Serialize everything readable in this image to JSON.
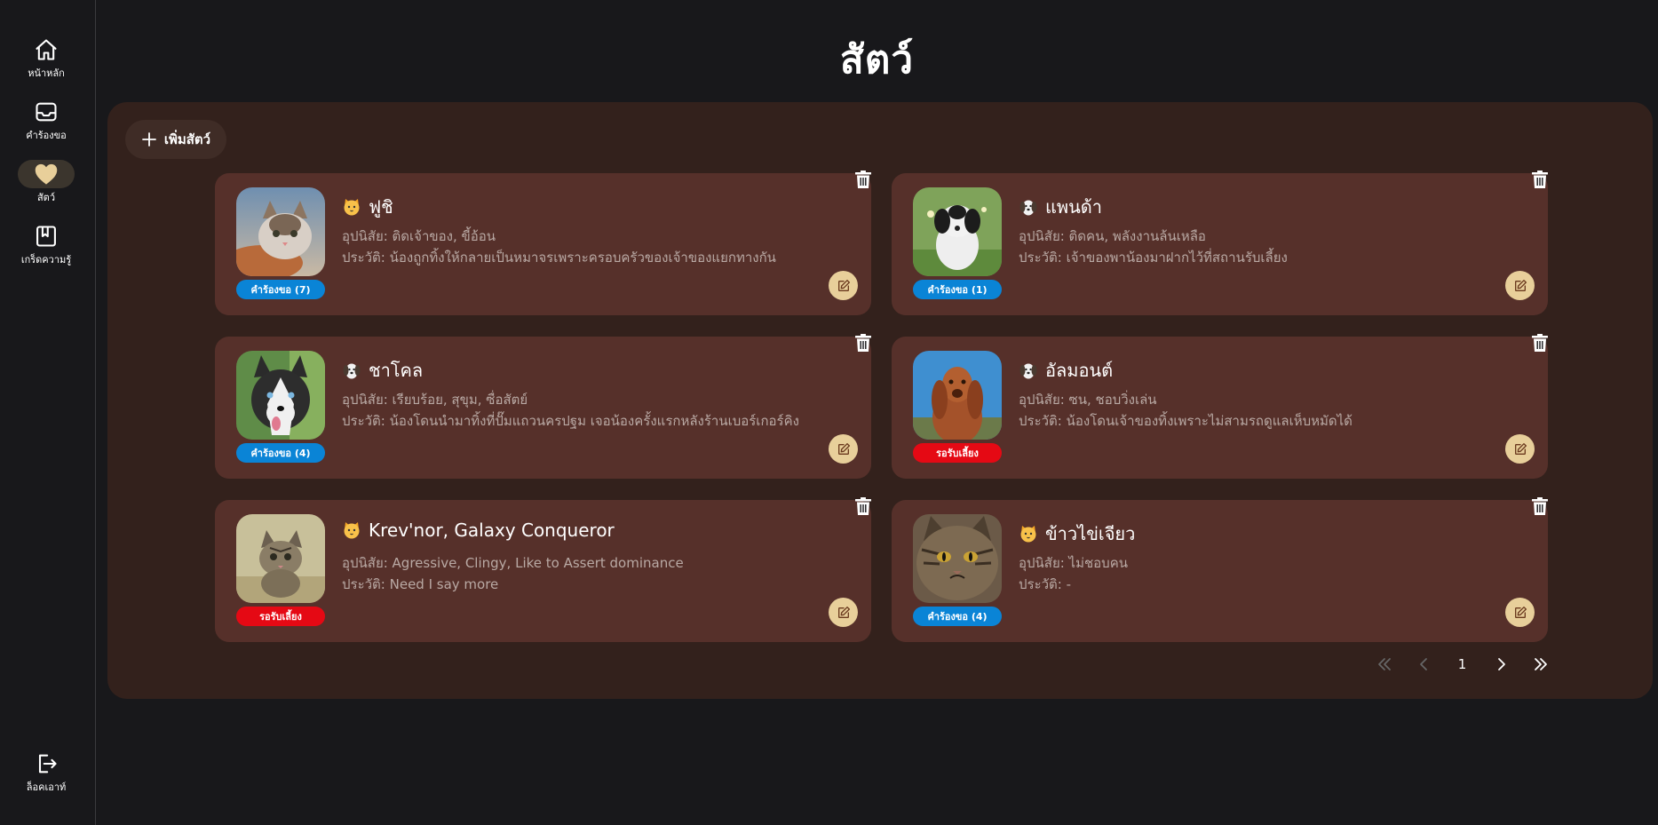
{
  "sidebar": {
    "items": [
      {
        "label": "หน้าหลัก",
        "icon": "home-icon"
      },
      {
        "label": "คำร้องขอ",
        "icon": "inbox-icon"
      },
      {
        "label": "สัตว์",
        "icon": "heart-icon",
        "active": true
      },
      {
        "label": "เกร็ดความรู้",
        "icon": "book-icon"
      }
    ],
    "logout_label": "ล็อคเอาท์"
  },
  "page": {
    "title": "สัตว์",
    "add_button_label": "เพิ่มสัตว์"
  },
  "colors": {
    "background": "#18181b",
    "panel": "#33211c",
    "card": "#56302a",
    "accent": "#e8cf9a",
    "badge_requests": "#0a84d6",
    "badge_waiting": "#e50914"
  },
  "pets": [
    {
      "species": "cat",
      "name": "ฟูชิ",
      "traits": "อุปนิสัย: ติดเจ้าของ, ขี้อ้อน",
      "history": "ประวัติ: น้องถูกทิ้งให้กลายเป็นหมาจรเพราะครอบครัวของเจ้าของแยกทางกัน",
      "badge": "คำร้องขอ (7)",
      "badge_type": "requests"
    },
    {
      "species": "dog",
      "name": "แพนด้า",
      "traits": "อุปนิสัย: ติดคน, พลังงานล้นเหลือ",
      "history": "ประวัติ: เจ้าของพาน้องมาฝากไว้ที่สถานรับเลี้ยง",
      "badge": "คำร้องขอ (1)",
      "badge_type": "requests"
    },
    {
      "species": "dog",
      "name": "ชาโคล",
      "traits": "อุปนิสัย: เรียบร้อย, สุขุม, ซื่อสัตย์",
      "history": "ประวัติ: น้องโดนนำมาทิ้งที่ปั๊มแถวนครปฐม เจอน้องครั้งแรกหลังร้านเบอร์เกอร์คิง",
      "badge": "คำร้องขอ (4)",
      "badge_type": "requests"
    },
    {
      "species": "dog",
      "name": "อัลมอนต์",
      "traits": "อุปนิสัย: ซน, ชอบวิ่งเล่น",
      "history": "ประวัติ: น้องโดนเจ้าของทิ้งเพราะไม่สามรถดูแลเห็บหมัดได้",
      "badge": "รอรับเลี้ยง",
      "badge_type": "waiting"
    },
    {
      "species": "cat",
      "name": "Krev'nor, Galaxy Conqueror",
      "traits": "อุปนิสัย: Agressive, Clingy, Like to Assert dominance",
      "history": "ประวัติ: Need I say more",
      "badge": "รอรับเลี้ยง",
      "badge_type": "waiting"
    },
    {
      "species": "cat",
      "name": "ข้าวไข่เจียว",
      "traits": "อุปนิสัย: ไม่ชอบคน",
      "history": "ประวัติ: -",
      "badge": "คำร้องขอ (4)",
      "badge_type": "requests"
    }
  ],
  "pagination": {
    "current_page": "1",
    "icons": [
      "first-page-icon",
      "prev-page-icon",
      "next-page-icon",
      "last-page-icon"
    ]
  }
}
